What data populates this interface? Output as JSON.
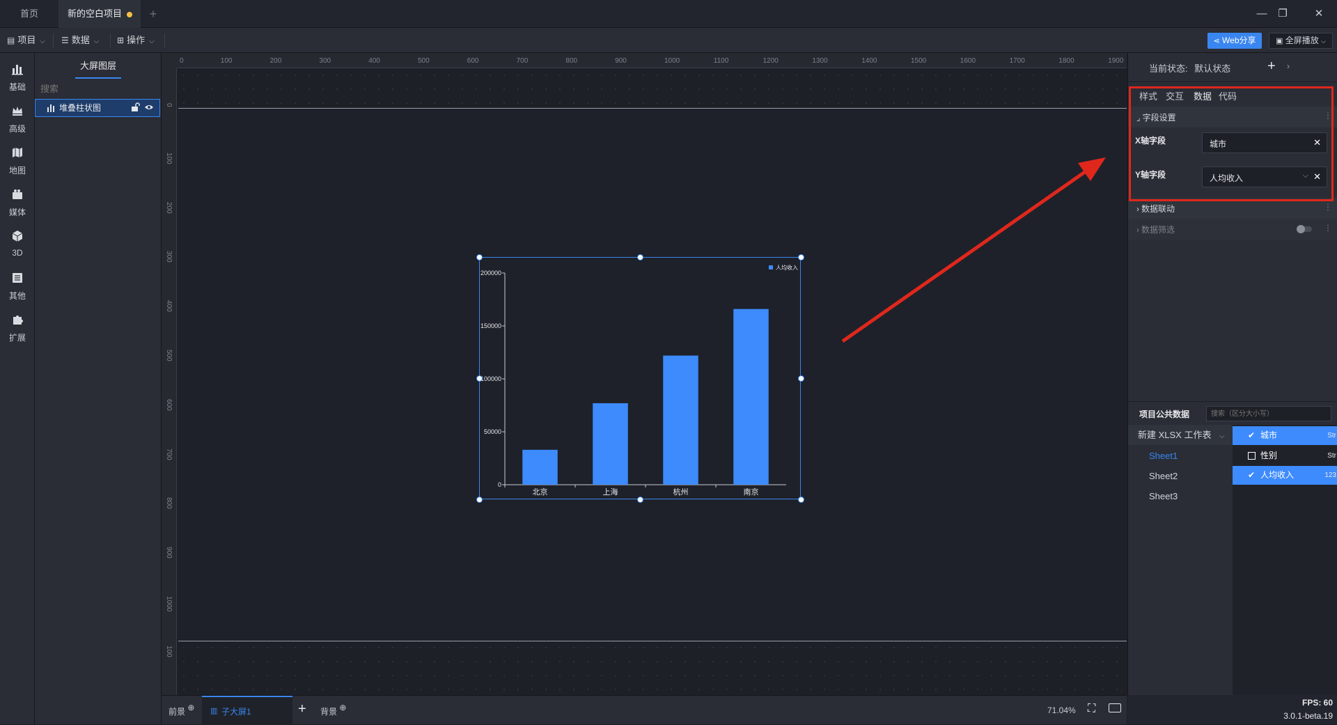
{
  "titlebar": {
    "tab_home": "首页",
    "tab_project": "新的空白项目",
    "tab_add": "+",
    "minimize": "—",
    "restore": "❐",
    "close": "✕"
  },
  "toolbar": {
    "menu_project": "项目",
    "menu_data": "数据",
    "menu_operate": "操作",
    "web_share": "Web分享",
    "fullscreen": "全屏播放"
  },
  "iconbar": [
    {
      "label": "基础",
      "icon": "bar-chart-icon"
    },
    {
      "label": "高级",
      "icon": "crown-icon"
    },
    {
      "label": "地图",
      "icon": "map-icon"
    },
    {
      "label": "媒体",
      "icon": "media-icon"
    },
    {
      "label": "3D",
      "icon": "cube-icon"
    },
    {
      "label": "其他",
      "icon": "list-icon"
    },
    {
      "label": "扩展",
      "icon": "puzzle-icon"
    }
  ],
  "layers": {
    "title": "大屏图层",
    "search_placeholder": "搜索",
    "items": [
      {
        "label": "堆叠柱状图"
      }
    ]
  },
  "ruler": {
    "h_ticks": [
      "0",
      "100",
      "200",
      "300",
      "400",
      "500",
      "600",
      "700",
      "800",
      "900",
      "1000",
      "1100",
      "1200",
      "1300",
      "1400",
      "1500",
      "1600",
      "1700",
      "1800",
      "1900"
    ],
    "v_ticks": [
      "0",
      "100",
      "200",
      "300",
      "400",
      "500",
      "600",
      "700",
      "800",
      "900",
      "1000",
      "100"
    ]
  },
  "chart_data": {
    "type": "bar",
    "categories": [
      "北京",
      "上海",
      "杭州",
      "南京"
    ],
    "series": [
      {
        "name": "人均收入",
        "values": [
          33000,
          77000,
          122000,
          166000
        ],
        "color": "#3d8bfd"
      }
    ],
    "y_ticks": [
      "0",
      "50000",
      "100000",
      "150000",
      "200000"
    ],
    "ylim": [
      0,
      200000
    ],
    "legend_position": "top-right",
    "grid": false
  },
  "right_panel": {
    "state_label": "当前状态:",
    "state_value": "默认状态",
    "tabs": [
      "样式",
      "交互",
      "数据",
      "代码"
    ],
    "active_tab": 2,
    "field_section": "字段设置",
    "x_field_label": "X轴字段",
    "x_field_value": "城市",
    "y_field_label": "Y轴字段",
    "y_field_value": "人均收入",
    "data_link": "数据联动",
    "data_filter": "数据筛选",
    "public_data_title": "项目公共数据",
    "public_search_placeholder": "搜索（区分大小写）",
    "workbook": "新建 XLSX 工作表",
    "sheets": [
      "Sheet1",
      "Sheet2",
      "Sheet3"
    ],
    "columns": [
      {
        "name": "城市",
        "type": "Str",
        "checked": true
      },
      {
        "name": "性别",
        "type": "Str",
        "checked": false
      },
      {
        "name": "人均收入",
        "type": "123",
        "checked": true
      }
    ]
  },
  "bottombar": {
    "foreground": "前景",
    "subscreen": "子大屏1",
    "background": "背景",
    "zoom": "71.04%"
  },
  "status": {
    "fps": "FPS: 60",
    "version": "3.0.1-beta.19"
  },
  "colors": {
    "accent": "#3a86f0",
    "highlight": "#e0271c"
  }
}
